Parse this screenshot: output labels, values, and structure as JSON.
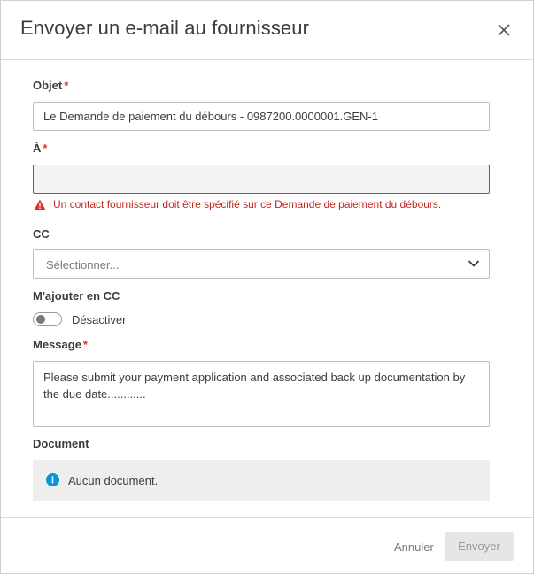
{
  "dialog": {
    "title": "Envoyer un e-mail au fournisseur"
  },
  "subject": {
    "label": "Objet",
    "required_mark": "*",
    "value": "Le Demande de paiement du débours - 0987200.0000001.GEN-1"
  },
  "to": {
    "label": "À",
    "required_mark": "*",
    "value": "",
    "error": "Un contact fournisseur doit être spécifié sur ce Demande de paiement du débours."
  },
  "cc": {
    "label": "CC",
    "placeholder": "Sélectionner..."
  },
  "add_me_cc": {
    "label": "M'ajouter en CC",
    "toggle_state": "Désactiver",
    "enabled": false
  },
  "message": {
    "label": "Message",
    "required_mark": "*",
    "value": "Please submit your payment application and associated back up documentation by the due date............"
  },
  "document": {
    "label": "Document",
    "empty_text": "Aucun document."
  },
  "footer": {
    "cancel_label": "Annuler",
    "send_label": "Envoyer"
  },
  "icons": {
    "close": "close-icon",
    "warning": "warning-icon",
    "chevron": "chevron-down-icon",
    "info": "info-icon"
  },
  "colors": {
    "error": "#d9342b",
    "info": "#0696d7",
    "disabled_button": "#e6e6e6"
  }
}
